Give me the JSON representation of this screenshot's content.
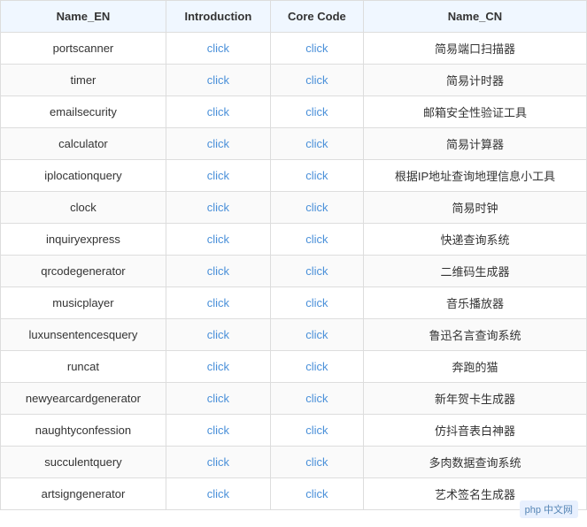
{
  "table": {
    "headers": [
      "Name_EN",
      "Introduction",
      "Core Code",
      "Name_CN"
    ],
    "rows": [
      {
        "name_en": "portscanner",
        "intro": "click",
        "core": "click",
        "name_cn": "简易端口扫描器"
      },
      {
        "name_en": "timer",
        "intro": "click",
        "core": "click",
        "name_cn": "简易计时器"
      },
      {
        "name_en": "emailsecurity",
        "intro": "click",
        "core": "click",
        "name_cn": "邮箱安全性验证工具"
      },
      {
        "name_en": "calculator",
        "intro": "click",
        "core": "click",
        "name_cn": "简易计算器"
      },
      {
        "name_en": "iplocationquery",
        "intro": "click",
        "core": "click",
        "name_cn": "根据IP地址查询地理信息小工具"
      },
      {
        "name_en": "clock",
        "intro": "click",
        "core": "click",
        "name_cn": "简易时钟"
      },
      {
        "name_en": "inquiryexpress",
        "intro": "click",
        "core": "click",
        "name_cn": "快递查询系统"
      },
      {
        "name_en": "qrcodegenerator",
        "intro": "click",
        "core": "click",
        "name_cn": "二维码生成器"
      },
      {
        "name_en": "musicplayer",
        "intro": "click",
        "core": "click",
        "name_cn": "音乐播放器"
      },
      {
        "name_en": "luxunsentencesquery",
        "intro": "click",
        "core": "click",
        "name_cn": "鲁迅名言查询系统"
      },
      {
        "name_en": "runcat",
        "intro": "click",
        "core": "click",
        "name_cn": "奔跑的猫"
      },
      {
        "name_en": "newyearcardgenerator",
        "intro": "click",
        "core": "click",
        "name_cn": "新年贺卡生成器"
      },
      {
        "name_en": "naughtyconfession",
        "intro": "click",
        "core": "click",
        "name_cn": "仿抖音表白神器"
      },
      {
        "name_en": "succulentquery",
        "intro": "click",
        "core": "click",
        "name_cn": "多肉数据查询系统"
      },
      {
        "name_en": "artsigngenerator",
        "intro": "click",
        "core": "click",
        "name_cn": "艺术签名生成器"
      }
    ]
  },
  "watermark": "php 中文网"
}
